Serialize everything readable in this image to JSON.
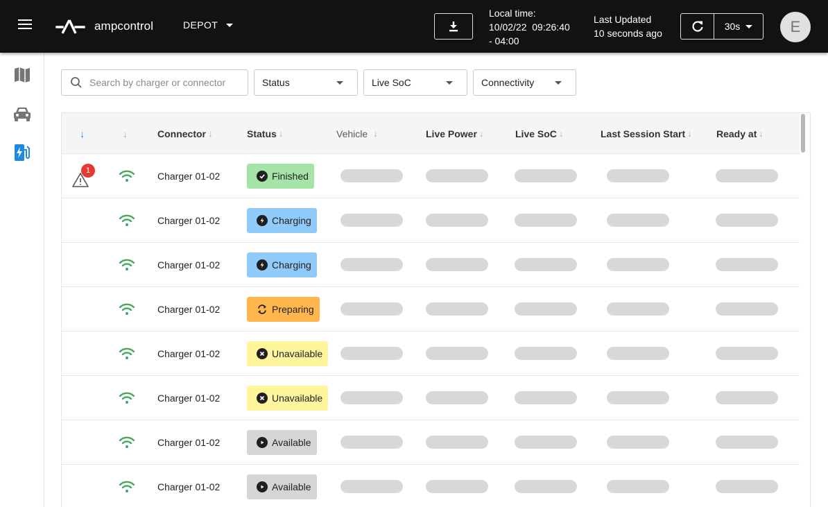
{
  "header": {
    "brand": "ampcontrol",
    "depot_label": "DEPOT",
    "local_time_label": "Local time:",
    "local_time_value": "10/02/22  09:26:40",
    "local_time_offset": "- 04:00",
    "last_updated_label": "Last Updated",
    "last_updated_value": "10 seconds ago",
    "refresh_interval": "30s",
    "avatar_initial": "E"
  },
  "sidebar": {
    "items": [
      {
        "name": "map",
        "icon": "map-icon"
      },
      {
        "name": "vehicles",
        "icon": "car-icon"
      },
      {
        "name": "chargers",
        "icon": "ev-charger-icon",
        "active": true
      }
    ],
    "active_color": "#1e88e5"
  },
  "filters": {
    "search_placeholder": "Search by charger or connector",
    "status": "Status",
    "live_soc": "Live SoC",
    "connectivity": "Connectivity"
  },
  "table": {
    "columns": {
      "connector": "Connector",
      "status": "Status",
      "vehicle": "Vehicle",
      "live_power": "Live Power",
      "live_soc": "Live SoC",
      "last_session_start": "Last Session Start",
      "ready_at": "Ready at"
    },
    "rows": [
      {
        "alert_count": "1",
        "connector": "Charger 01-02",
        "status": "Finished"
      },
      {
        "alert_count": "",
        "connector": "Charger 01-02",
        "status": "Charging"
      },
      {
        "alert_count": "",
        "connector": "Charger 01-02",
        "status": "Charging"
      },
      {
        "alert_count": "",
        "connector": "Charger 01-02",
        "status": "Preparing"
      },
      {
        "alert_count": "",
        "connector": "Charger 01-02",
        "status": "Unavailable"
      },
      {
        "alert_count": "",
        "connector": "Charger 01-02",
        "status": "Unavailable"
      },
      {
        "alert_count": "",
        "connector": "Charger 01-02",
        "status": "Available"
      },
      {
        "alert_count": "",
        "connector": "Charger 01-02",
        "status": "Available"
      }
    ]
  },
  "status_colors": {
    "Finished": "#a5e3a7",
    "Charging": "#90caf9",
    "Preparing": "#ffb74d",
    "Unavailable": "#fff59d",
    "Available": "#d5d5d5"
  },
  "status_icons": {
    "Finished": "check-circle-icon",
    "Charging": "bolt-circle-icon",
    "Preparing": "sync-icon",
    "Unavailable": "x-circle-icon",
    "Available": "play-circle-icon"
  },
  "connectivity_color": "#43a85a"
}
